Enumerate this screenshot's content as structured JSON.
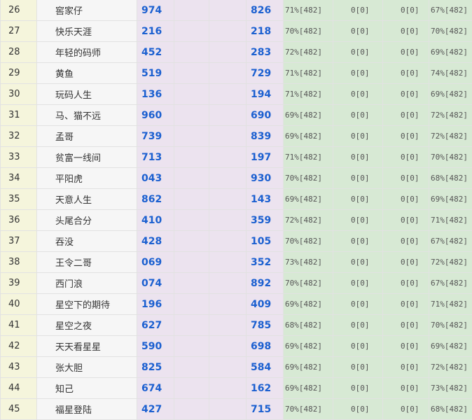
{
  "rows": [
    {
      "rank": "26",
      "name": "窖家仔",
      "num1": "974",
      "num2": "826",
      "p1": "71%[482]",
      "z1": "0[0]",
      "z2": "0[0]",
      "p2": "67%[482]"
    },
    {
      "rank": "27",
      "name": "快乐天涯",
      "num1": "216",
      "num2": "218",
      "p1": "70%[482]",
      "z1": "0[0]",
      "z2": "0[0]",
      "p2": "70%[482]"
    },
    {
      "rank": "28",
      "name": "年轻的码师",
      "num1": "452",
      "num2": "283",
      "p1": "72%[482]",
      "z1": "0[0]",
      "z2": "0[0]",
      "p2": "69%[482]"
    },
    {
      "rank": "29",
      "name": "黄鱼",
      "num1": "519",
      "num2": "729",
      "p1": "71%[482]",
      "z1": "0[0]",
      "z2": "0[0]",
      "p2": "74%[482]"
    },
    {
      "rank": "30",
      "name": "玩码人生",
      "num1": "136",
      "num2": "194",
      "p1": "71%[482]",
      "z1": "0[0]",
      "z2": "0[0]",
      "p2": "69%[482]"
    },
    {
      "rank": "31",
      "name": "马、猫不远",
      "num1": "960",
      "num2": "690",
      "p1": "69%[482]",
      "z1": "0[0]",
      "z2": "0[0]",
      "p2": "72%[482]"
    },
    {
      "rank": "32",
      "name": "孟哥",
      "num1": "739",
      "num2": "839",
      "p1": "69%[482]",
      "z1": "0[0]",
      "z2": "0[0]",
      "p2": "72%[482]"
    },
    {
      "rank": "33",
      "name": "贫富一线间",
      "num1": "713",
      "num2": "197",
      "p1": "71%[482]",
      "z1": "0[0]",
      "z2": "0[0]",
      "p2": "70%[482]"
    },
    {
      "rank": "34",
      "name": "平阳虎",
      "num1": "043",
      "num2": "930",
      "p1": "70%[482]",
      "z1": "0[0]",
      "z2": "0[0]",
      "p2": "68%[482]"
    },
    {
      "rank": "35",
      "name": "天意人生",
      "num1": "862",
      "num2": "143",
      "p1": "69%[482]",
      "z1": "0[0]",
      "z2": "0[0]",
      "p2": "69%[482]"
    },
    {
      "rank": "36",
      "name": "头尾合分",
      "num1": "410",
      "num2": "359",
      "p1": "72%[482]",
      "z1": "0[0]",
      "z2": "0[0]",
      "p2": "71%[482]"
    },
    {
      "rank": "37",
      "name": "吞没",
      "num1": "428",
      "num2": "105",
      "p1": "70%[482]",
      "z1": "0[0]",
      "z2": "0[0]",
      "p2": "67%[482]"
    },
    {
      "rank": "38",
      "name": "王令二哥",
      "num1": "069",
      "num2": "352",
      "p1": "73%[482]",
      "z1": "0[0]",
      "z2": "0[0]",
      "p2": "72%[482]"
    },
    {
      "rank": "39",
      "name": "西门浪",
      "num1": "074",
      "num2": "892",
      "p1": "70%[482]",
      "z1": "0[0]",
      "z2": "0[0]",
      "p2": "67%[482]"
    },
    {
      "rank": "40",
      "name": "星空下的期待",
      "num1": "196",
      "num2": "409",
      "p1": "69%[482]",
      "z1": "0[0]",
      "z2": "0[0]",
      "p2": "71%[482]"
    },
    {
      "rank": "41",
      "name": "星空之夜",
      "num1": "627",
      "num2": "785",
      "p1": "68%[482]",
      "z1": "0[0]",
      "z2": "0[0]",
      "p2": "70%[482]"
    },
    {
      "rank": "42",
      "name": "天天看星星",
      "num1": "590",
      "num2": "698",
      "p1": "69%[482]",
      "z1": "0[0]",
      "z2": "0[0]",
      "p2": "69%[482]"
    },
    {
      "rank": "43",
      "name": "张大胆",
      "num1": "825",
      "num2": "584",
      "p1": "69%[482]",
      "z1": "0[0]",
      "z2": "0[0]",
      "p2": "72%[482]"
    },
    {
      "rank": "44",
      "name": "知己",
      "num1": "674",
      "num2": "162",
      "p1": "69%[482]",
      "z1": "0[0]",
      "z2": "0[0]",
      "p2": "73%[482]"
    },
    {
      "rank": "45",
      "name": "福星登陆",
      "num1": "427",
      "num2": "715",
      "p1": "70%[482]",
      "z1": "0[0]",
      "z2": "0[0]",
      "p2": "68%[482]"
    }
  ]
}
